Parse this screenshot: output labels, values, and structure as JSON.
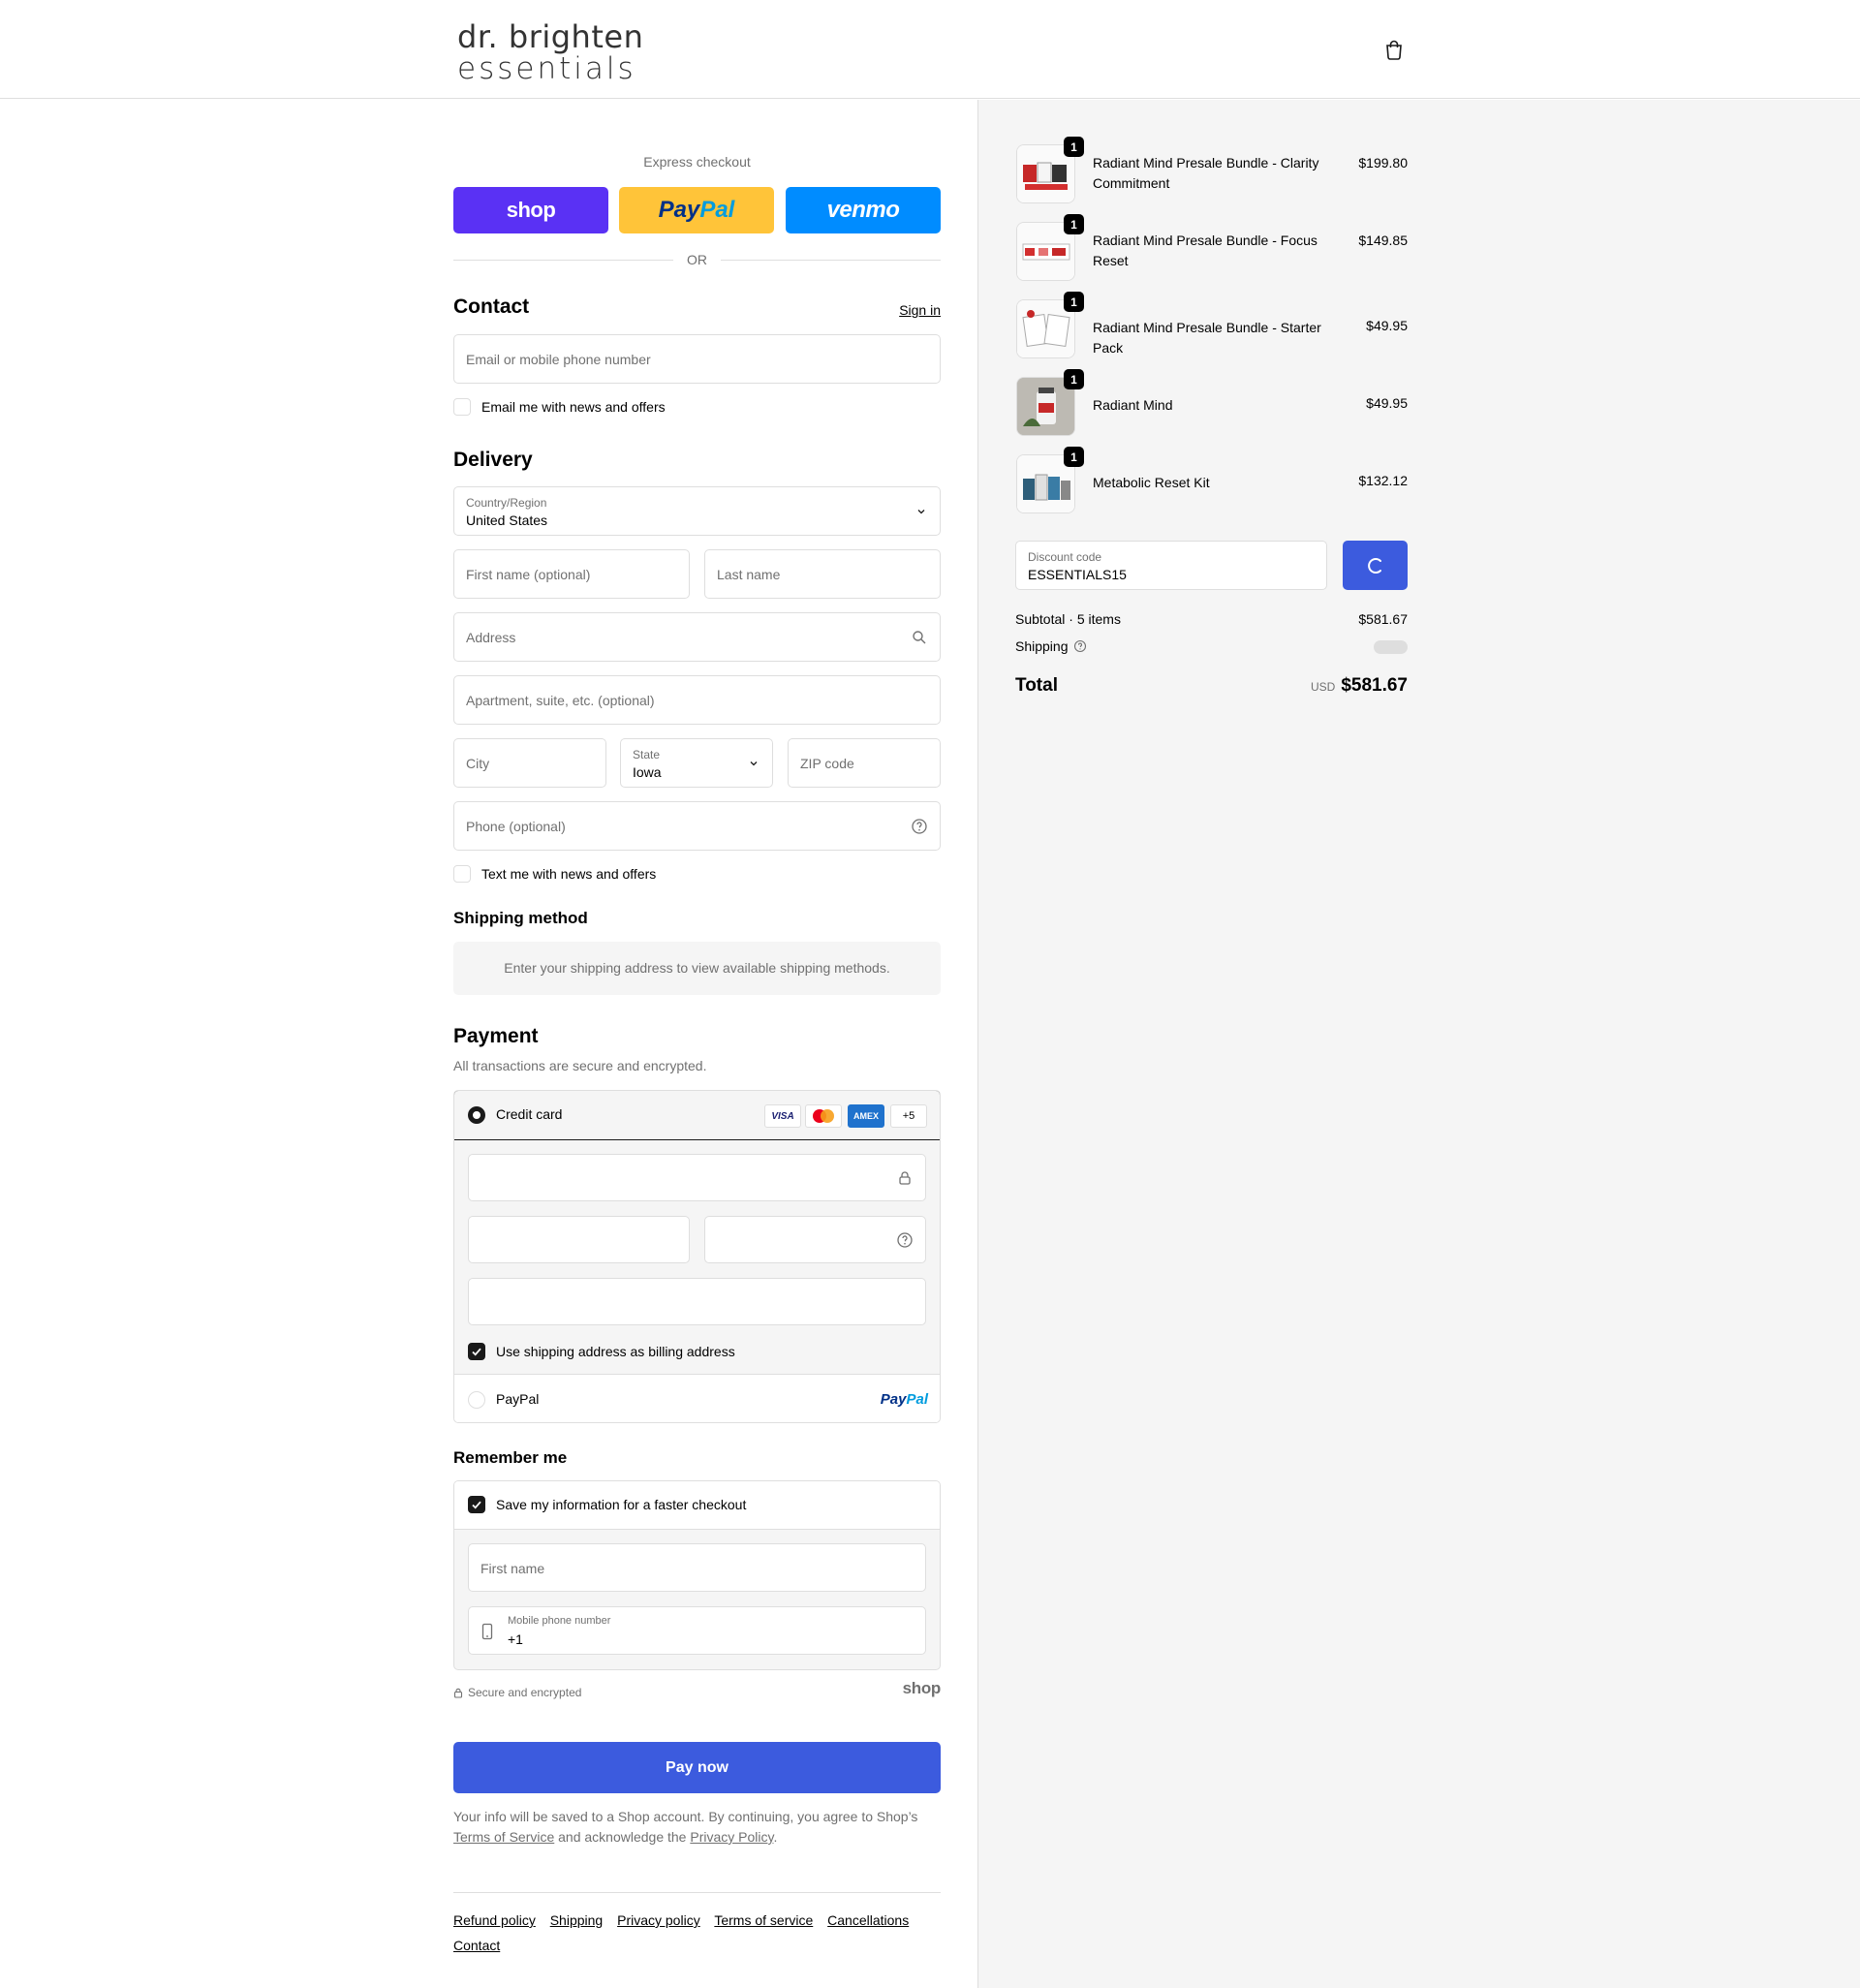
{
  "header": {
    "logo_line1": "dr. brighten",
    "logo_line2": "essentials"
  },
  "express": {
    "title": "Express checkout",
    "shop": "shop",
    "paypal_a": "Pay",
    "paypal_b": "Pal",
    "venmo": "venmo",
    "or": "OR"
  },
  "contact": {
    "heading": "Contact",
    "sign_in": "Sign in",
    "email_placeholder": "Email or mobile phone number",
    "news_checkbox": "Email me with news and offers"
  },
  "delivery": {
    "heading": "Delivery",
    "country_label": "Country/Region",
    "country_value": "United States",
    "first_name": "First name (optional)",
    "last_name": "Last name",
    "address": "Address",
    "apartment": "Apartment, suite, etc. (optional)",
    "city": "City",
    "state_label": "State",
    "state_value": "Iowa",
    "zip": "ZIP code",
    "phone": "Phone (optional)",
    "text_checkbox": "Text me with news and offers"
  },
  "shipping_method": {
    "heading": "Shipping method",
    "notice": "Enter your shipping address to view available shipping methods."
  },
  "payment": {
    "heading": "Payment",
    "subtitle": "All transactions are secure and encrypted.",
    "credit_card": "Credit card",
    "cards": [
      "VISA",
      "MC",
      "AMEX",
      "+5"
    ],
    "billing_checkbox": "Use shipping address as billing address",
    "paypal": "PayPal",
    "paypal_logo_a": "Pay",
    "paypal_logo_b": "Pal"
  },
  "remember": {
    "heading": "Remember me",
    "save_checkbox": "Save my information for a faster checkout",
    "first_name": "First name",
    "phone_label": "Mobile phone number",
    "phone_value": "+1",
    "secure": "Secure and encrypted",
    "shop_mark": "shop"
  },
  "pay_now": "Pay now",
  "legal": {
    "text1": "Your info will be saved to a Shop account. By continuing, you agree to Shop’s",
    "terms": "Terms of Service",
    "text2": "and acknowledge the",
    "privacy": "Privacy Policy",
    "text3": "."
  },
  "footer": {
    "links": [
      "Refund policy",
      "Shipping",
      "Privacy policy",
      "Terms of service",
      "Cancellations",
      "Contact"
    ]
  },
  "order": {
    "items": [
      {
        "name": "Radiant Mind Presale Bundle - Clarity Commitment",
        "price": "$199.80",
        "qty": "1"
      },
      {
        "name": "Radiant Mind Presale Bundle - Focus Reset",
        "price": "$149.85",
        "qty": "1"
      },
      {
        "name": "Radiant Mind Presale Bundle - Starter Pack",
        "price": "$49.95",
        "qty": "1"
      },
      {
        "name": "Radiant Mind",
        "price": "$49.95",
        "qty": "1"
      },
      {
        "name": "Metabolic Reset Kit",
        "price": "$132.12",
        "qty": "1"
      }
    ],
    "discount_label": "Discount code",
    "discount_value": "ESSENTIALS15",
    "subtotal_label": "Subtotal · 5 items",
    "subtotal_value": "$581.67",
    "shipping_label": "Shipping",
    "total_label": "Total",
    "currency": "USD",
    "total_value": "$581.67"
  },
  "colors": {
    "accent": "#3c5bde",
    "shop_purple": "#5a31f4",
    "paypal_yellow": "#ffc439",
    "venmo_blue": "#008cff"
  }
}
